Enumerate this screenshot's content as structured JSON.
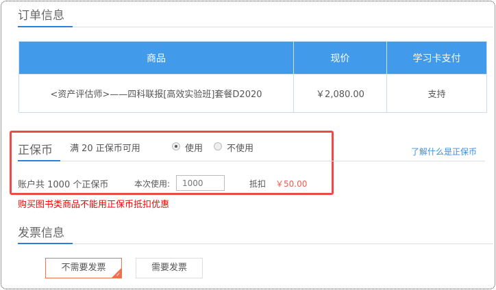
{
  "order": {
    "title": "订单信息",
    "columns": [
      "商品",
      "现价",
      "学习卡支付"
    ],
    "rows": [
      [
        "<资产评估师>——四科联报[高效实验班]套餐D2020",
        "￥2,080.00",
        "支持"
      ]
    ]
  },
  "coin": {
    "title": "正保币",
    "condition": "满 20 正保币可用",
    "options": [
      {
        "label": "使用",
        "selected": true
      },
      {
        "label": "不使用",
        "selected": false
      }
    ],
    "link": "了解什么是正保币",
    "balance": "账户共 1000 个正保币",
    "use_label": "本次使用:",
    "use_placeholder": "1000",
    "deduct_label": "抵扣",
    "deduct_amount": "￥50.00",
    "warning": "购买图书类商品不能用正保币抵扣优惠"
  },
  "invoice": {
    "title": "发票信息",
    "options": [
      {
        "label": "不需要发票",
        "selected": true
      },
      {
        "label": "需要发票",
        "selected": false
      }
    ]
  }
}
